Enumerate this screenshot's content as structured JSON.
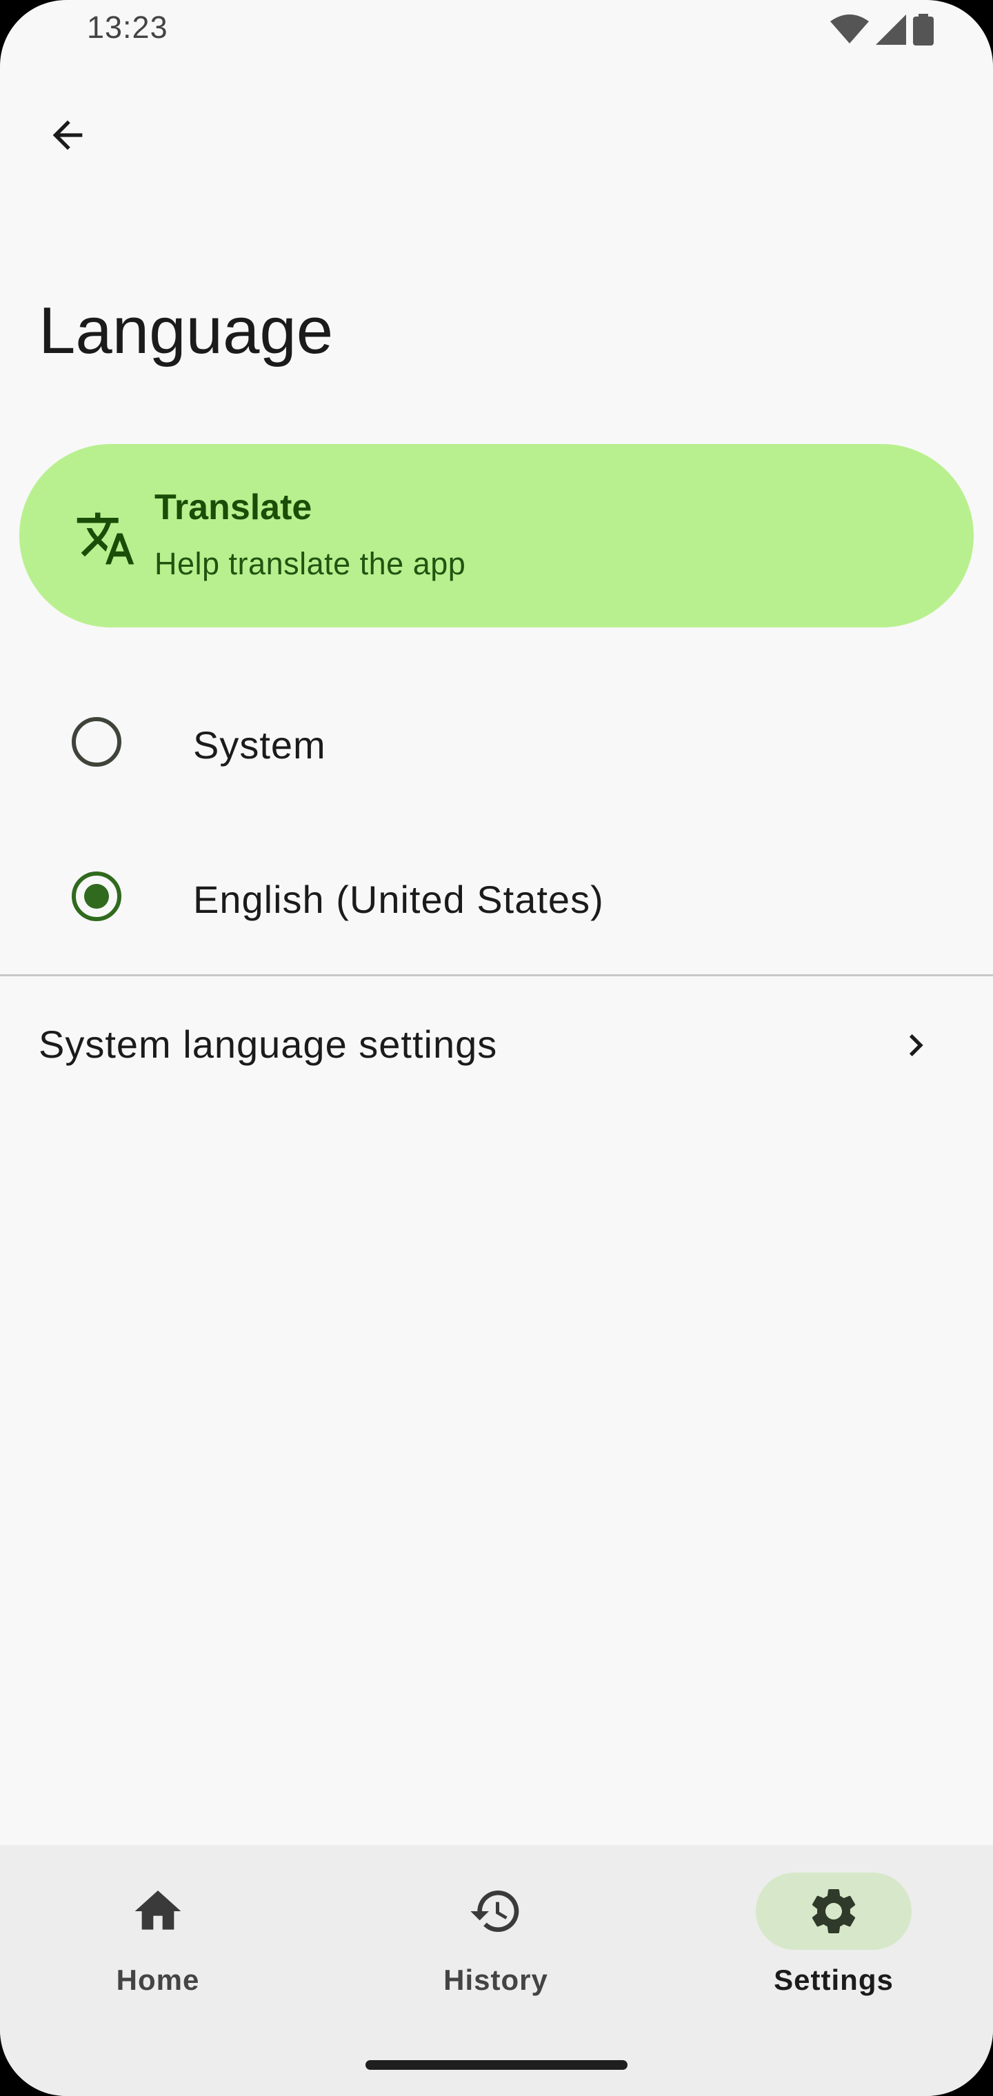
{
  "status_bar": {
    "time": "13:23",
    "icons": [
      "wifi-icon",
      "cell-signal-icon",
      "battery-icon"
    ]
  },
  "top_bar": {
    "back_icon": "arrow-back-icon"
  },
  "page": {
    "title": "Language"
  },
  "translate_card": {
    "icon": "translate-icon",
    "title": "Translate",
    "subtitle": "Help translate the app",
    "background": "#b9f08f"
  },
  "language_options": [
    {
      "label": "System",
      "selected": false
    },
    {
      "label": "English (United States)",
      "selected": true
    }
  ],
  "system_settings_link": {
    "label": "System language settings",
    "icon": "chevron-right-icon"
  },
  "bottom_nav": {
    "items": [
      {
        "label": "Home",
        "icon": "home-icon",
        "active": false
      },
      {
        "label": "History",
        "icon": "history-icon",
        "active": false
      },
      {
        "label": "Settings",
        "icon": "gear-icon",
        "active": true
      }
    ]
  },
  "colors": {
    "accent": "#306a1e",
    "surface": "#f8f8f8",
    "nav_background": "#ededed",
    "active_pill": "#d6e8c9"
  }
}
